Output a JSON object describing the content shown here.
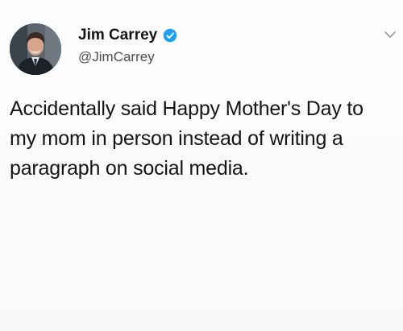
{
  "author": {
    "display_name": "Jim Carrey",
    "handle": "@JimCarrey",
    "verified": true
  },
  "tweet": {
    "text": "Accidentally said Happy Mother's Day to my mom in person instead of writing a paragraph on social media."
  },
  "icons": {
    "avatar": "profile-photo",
    "verified": "verified-badge-icon",
    "menu": "chevron-down-icon"
  },
  "colors": {
    "verified_badge": "#1da1f2",
    "background": "#fbfbfb",
    "text": "#141414",
    "handle": "#4c4c4c"
  }
}
